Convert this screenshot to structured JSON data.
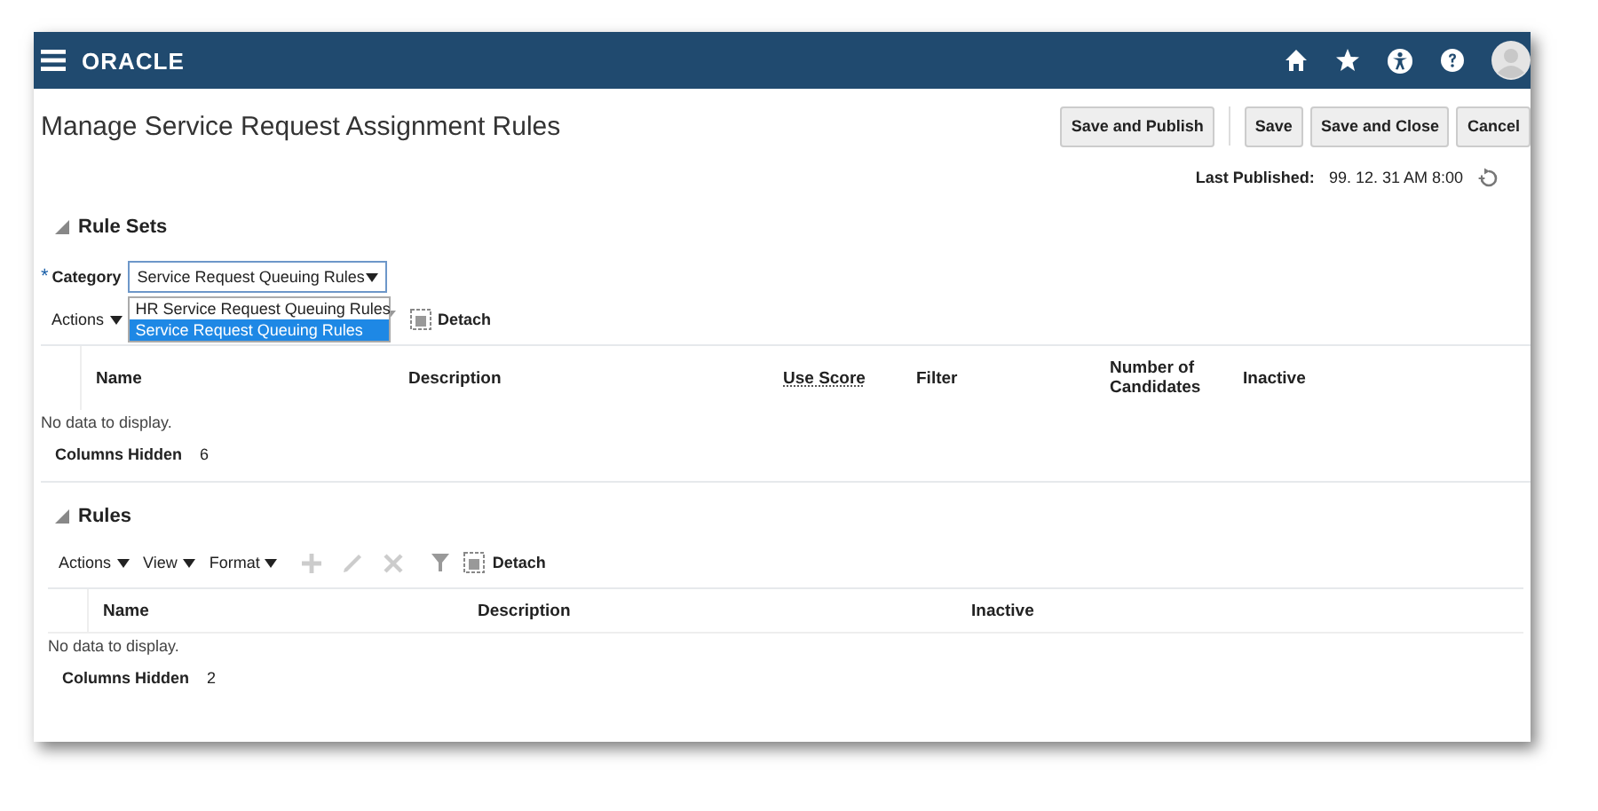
{
  "header": {
    "logo": "ORACLE"
  },
  "page": {
    "title": "Manage Service Request Assignment Rules",
    "buttons": [
      {
        "label": "Save and Publish",
        "separator_before": false
      },
      {
        "label": "Save",
        "separator_before": true
      },
      {
        "label": "Save and Close",
        "separator_before": false
      },
      {
        "label": "Cancel",
        "separator_before": false
      }
    ],
    "last_published": {
      "label": "Last Published:",
      "value": "99. 12. 31 AM 8:00"
    }
  },
  "rule_sets": {
    "title": "Rule Sets",
    "expanded": true,
    "category": {
      "label": "Category",
      "required_mark": "*",
      "value": "Service Request Queuing Rules",
      "options": [
        {
          "label": "HR Service Request Queuing Rules",
          "selected": false
        },
        {
          "label": "Service Request Queuing Rules",
          "selected": true
        }
      ]
    },
    "toolbar": {
      "actions": "Actions",
      "detach": "Detach"
    },
    "columns": [
      {
        "label": "Name",
        "underlined": false
      },
      {
        "label": "Description",
        "underlined": false
      },
      {
        "label": "Use Score",
        "underlined": true
      },
      {
        "label": "Filter",
        "underlined": false
      },
      {
        "label": "Number of Candidates",
        "underlined": false
      },
      {
        "label": "Inactive",
        "underlined": false
      }
    ],
    "empty_text": "No data to display.",
    "columns_hidden": {
      "label": "Columns Hidden",
      "value": "6"
    }
  },
  "rules": {
    "title": "Rules",
    "expanded": true,
    "toolbar": {
      "menus": [
        "Actions",
        "View",
        "Format"
      ],
      "detach": "Detach"
    },
    "columns": [
      {
        "label": "Name",
        "underlined": false
      },
      {
        "label": "Description",
        "underlined": false
      },
      {
        "label": "Inactive",
        "underlined": false
      }
    ],
    "empty_text": "No data to display.",
    "columns_hidden": {
      "label": "Columns Hidden",
      "value": "2"
    }
  }
}
